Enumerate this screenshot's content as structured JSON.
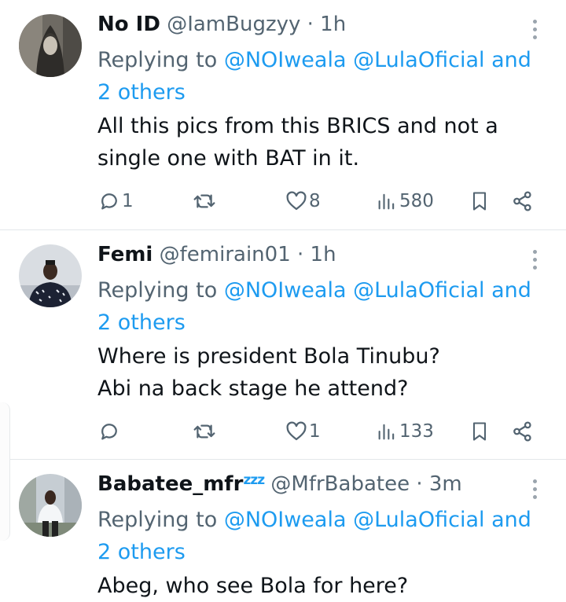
{
  "tweets": [
    {
      "name": "No ID",
      "name_emoji": "",
      "handle_time": "@IamBugzyy · 1h",
      "replying_prefix": "Replying to",
      "mention1": "@NOIweala",
      "mention2": "@LulaOficial",
      "and": "and",
      "others": "2 others",
      "text": [
        "All this pics from this BRICS and not a",
        "single one with BAT in it."
      ],
      "stats": {
        "replies": "1",
        "retweets": "",
        "likes": "8",
        "views": "580"
      }
    },
    {
      "name": "Femi",
      "name_emoji": "",
      "handle_time": "@femirain01 · 1h",
      "replying_prefix": "Replying to",
      "mention1": "@NOIweala",
      "mention2": "@LulaOficial",
      "and": "and",
      "others": "2 others",
      "text": [
        "Where is president Bola Tinubu?",
        "Abi na back stage he attend?"
      ],
      "stats": {
        "replies": "",
        "retweets": "",
        "likes": "1",
        "views": "133"
      }
    },
    {
      "name": "Babatee_mfr",
      "name_emoji": "zzz",
      "handle_time": "@MfrBabatee · 3m",
      "replying_prefix": "Replying to",
      "mention1": "@NOIweala",
      "mention2": "@LulaOficial",
      "and": "and",
      "others": "2 others",
      "text": [
        "Abeg, who see Bola for here?"
      ],
      "stats": {
        "replies": "",
        "retweets": "",
        "likes": "",
        "views": ""
      }
    }
  ],
  "icons": {
    "reply": "reply-icon",
    "retweet": "retweet-icon",
    "like": "heart-icon",
    "views": "views-icon",
    "bookmark": "bookmark-icon",
    "share": "share-icon",
    "more": "more-icon"
  },
  "colors": {
    "accent": "#1d9bf0",
    "muted": "#536471",
    "text": "#0f1419"
  }
}
